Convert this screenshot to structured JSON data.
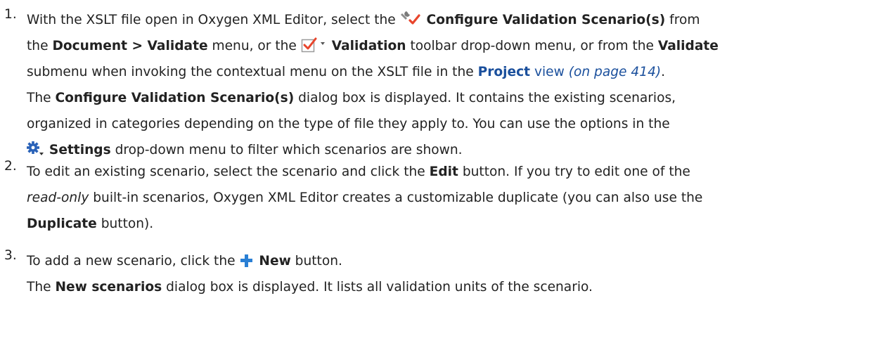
{
  "steps": [
    {
      "number": "1.",
      "p1": "With the XSLT file open in Oxygen XML Editor, select the ",
      "cfg_label": "Configure Validation Scenario(s)",
      "p2": " from",
      "p3": "the ",
      "menu_path": "Document > Validate",
      "p4": " menu, or the ",
      "validation_label": "Validation",
      "p5": " toolbar drop-down menu, or from the ",
      "validate_label": "Validate",
      "p6": "submenu when invoking the contextual menu on the XSLT file in the ",
      "project_link": "Project",
      "view_link": " view",
      "page_ref": "(on page 414)",
      "p7": ".",
      "p8": "The ",
      "dialog_label": "Configure Validation Scenario(s)",
      "p9": " dialog box is displayed. It contains the existing scenarios,",
      "p10": "organized in categories depending on the type of file they apply to. You can use the options in the",
      "settings_label": "Settings",
      "p11": " drop-down menu to filter which scenarios are shown."
    },
    {
      "number": "2.",
      "p1": "To edit an existing scenario, select the scenario and click the ",
      "edit_label": "Edit",
      "p2": " button. If you try to edit one of the",
      "readonly": "read-only",
      "p3": " built-in scenarios, Oxygen XML Editor creates a customizable duplicate (you can also use the",
      "duplicate_label": "Duplicate",
      "p4": " button)."
    },
    {
      "number": "3.",
      "p1": "To add a new scenario, click the ",
      "new_label": "New",
      "p2": " button.",
      "p3": "The ",
      "new_dialog_label": "New scenarios",
      "p4": " dialog box is displayed. It lists all validation units of the scenario."
    }
  ],
  "icons": {
    "configure": "wrench-check-icon",
    "validation": "validation-check-icon",
    "dropdown": "dropdown-arrow-icon",
    "settings": "gear-icon",
    "new": "plus-icon"
  },
  "colors": {
    "link": "#1a4f9c",
    "check_red": "#e8452c",
    "plus_blue": "#2a7fd4"
  }
}
